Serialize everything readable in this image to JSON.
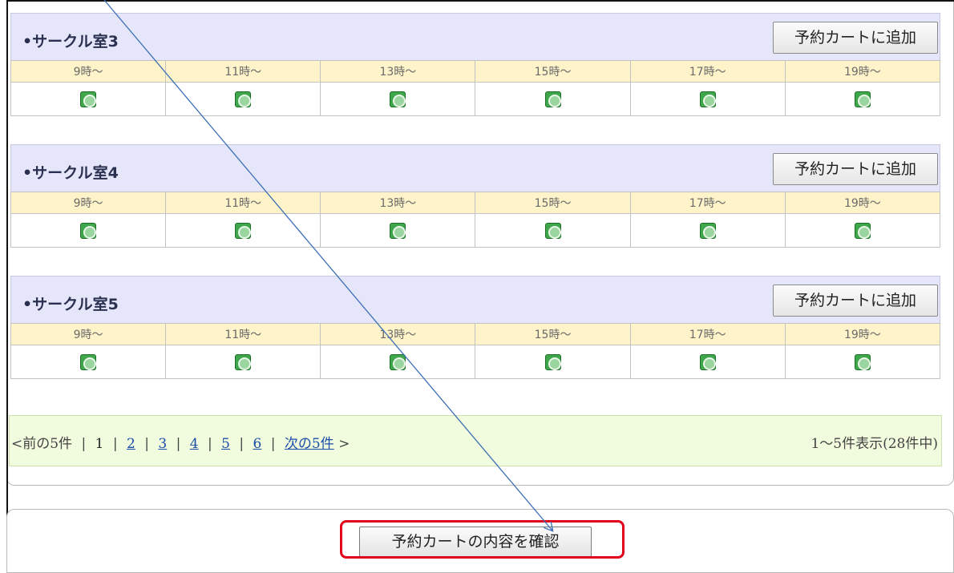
{
  "rooms": [
    {
      "name": "•サークル室3",
      "add_label": "予約カートに追加",
      "slots": [
        "9時～",
        "11時～",
        "13時～",
        "15時～",
        "17時～",
        "19時～"
      ]
    },
    {
      "name": "•サークル室4",
      "add_label": "予約カートに追加",
      "slots": [
        "9時～",
        "11時～",
        "13時～",
        "15時～",
        "17時～",
        "19時～"
      ]
    },
    {
      "name": "•サークル室5",
      "add_label": "予約カートに追加",
      "slots": [
        "9時～",
        "11時～",
        "13時～",
        "15時～",
        "17時～",
        "19時～"
      ]
    }
  ],
  "slot_status_icon": "available-circle-icon",
  "pager": {
    "prev": "<前の5件",
    "pages": [
      "1",
      "2",
      "3",
      "4",
      "5",
      "6"
    ],
    "current_page": "1",
    "next": "次の5件",
    "next_arrow": ">",
    "summary": "1～5件表示(28件中)"
  },
  "confirm_label": "予約カートの内容を確認",
  "colors": {
    "room_header_bg": "#e6e6fa",
    "time_row_bg": "#fff4c9",
    "pager_bg": "#f1fbdd",
    "link": "#1a4fa8",
    "highlight": "#e0001b",
    "arrow": "#3b6fb6",
    "available": "#3fa64b"
  }
}
